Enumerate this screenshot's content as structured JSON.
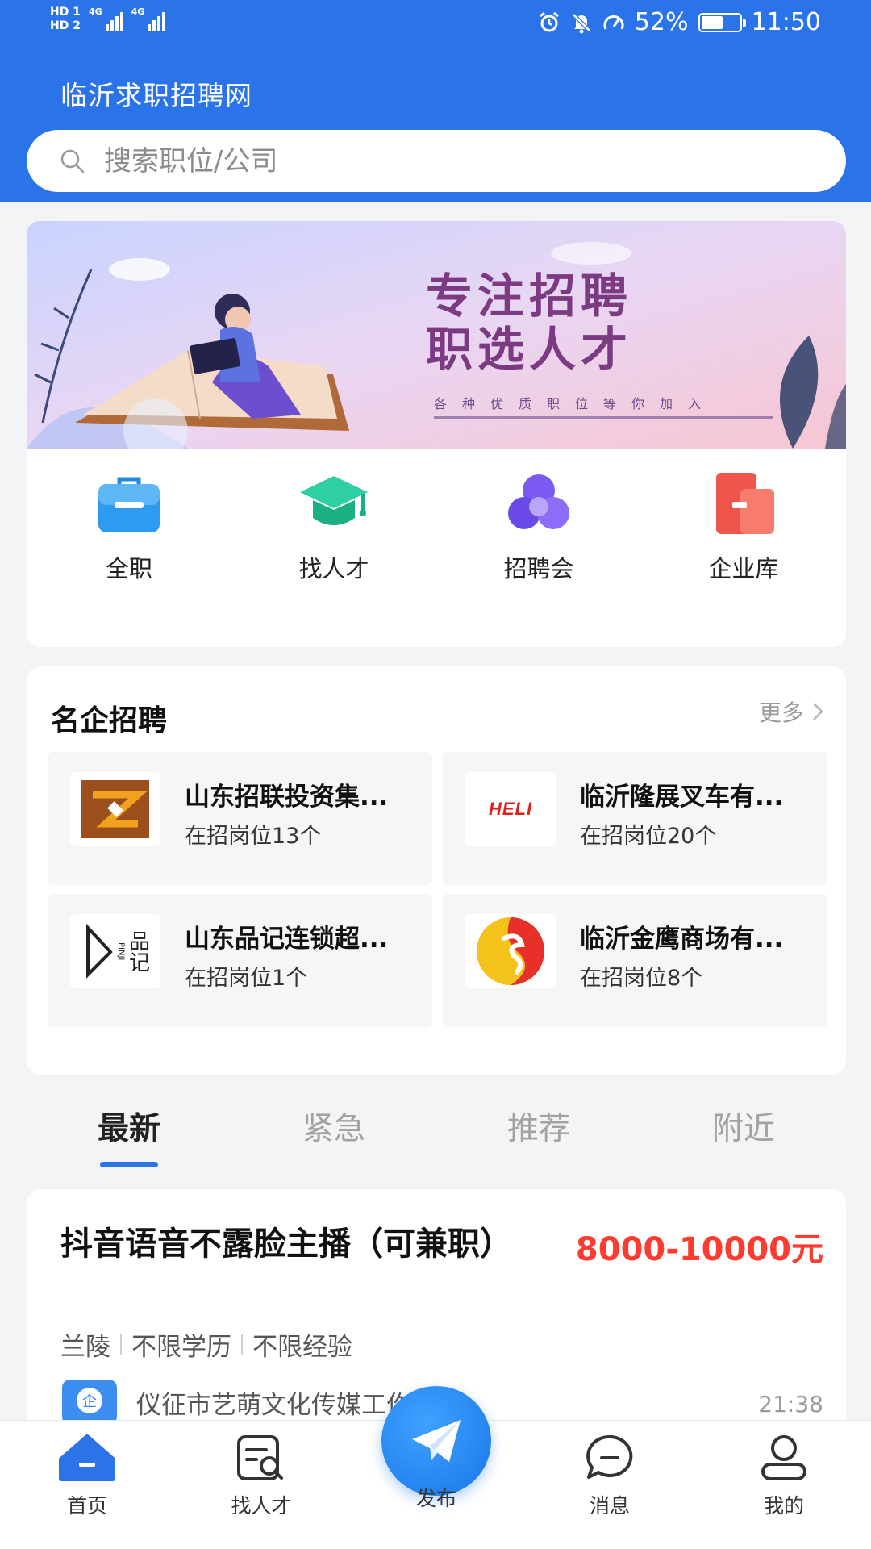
{
  "status_bar": {
    "hd1": "HD 1",
    "hd2": "HD 2",
    "sig1_label": "4G",
    "sig2_label": "4G",
    "battery_percent": "52%",
    "battery_level": 52,
    "time": "11:50"
  },
  "header": {
    "title": "临沂求职招聘网"
  },
  "search": {
    "placeholder": "搜索职位/公司"
  },
  "banner": {
    "line1": "专注招聘",
    "line2": "职选人才",
    "subtitle": "各种优质职位等你加入"
  },
  "categories": [
    {
      "label": "全职",
      "icon": "briefcase-icon"
    },
    {
      "label": "找人才",
      "icon": "graduation-cap-icon"
    },
    {
      "label": "招聘会",
      "icon": "circles-icon"
    },
    {
      "label": "企业库",
      "icon": "buildings-icon"
    }
  ],
  "famous": {
    "title": "名企招聘",
    "more_label": "更多",
    "companies": [
      {
        "name": "山东招联投资集...",
        "count": "在招岗位13个"
      },
      {
        "name": "临沂隆展叉车有...",
        "count": "在招岗位20个",
        "logo_text": "HELI"
      },
      {
        "name": "山东品记连锁超...",
        "count": "在招岗位1个",
        "logo_text": "品记",
        "logo_text_small": "PINJI"
      },
      {
        "name": "临沂金鹰商场有...",
        "count": "在招岗位8个"
      }
    ]
  },
  "tabs": [
    {
      "label": "最新",
      "active": true
    },
    {
      "label": "紧急",
      "active": false
    },
    {
      "label": "推荐",
      "active": false
    },
    {
      "label": "附近",
      "active": false
    }
  ],
  "job": {
    "title": "抖音语音不露脸主播（可兼职）",
    "salary": "8000-10000元",
    "tags": [
      "兰陵",
      "不限学历",
      "不限经验"
    ],
    "company": "仪征市艺萌文化传媒工作室",
    "company_logo_text": "企",
    "time": "21:38"
  },
  "bottom_nav": [
    {
      "label": "首页",
      "icon": "home-icon"
    },
    {
      "label": "找人才",
      "icon": "find-talent-icon"
    },
    {
      "label": "发布",
      "icon": "paper-plane-icon"
    },
    {
      "label": "消息",
      "icon": "message-icon"
    },
    {
      "label": "我的",
      "icon": "user-icon"
    }
  ],
  "colors": {
    "primary": "#2a73e8",
    "salary": "#ff3b30",
    "background": "#f3f4f6"
  }
}
